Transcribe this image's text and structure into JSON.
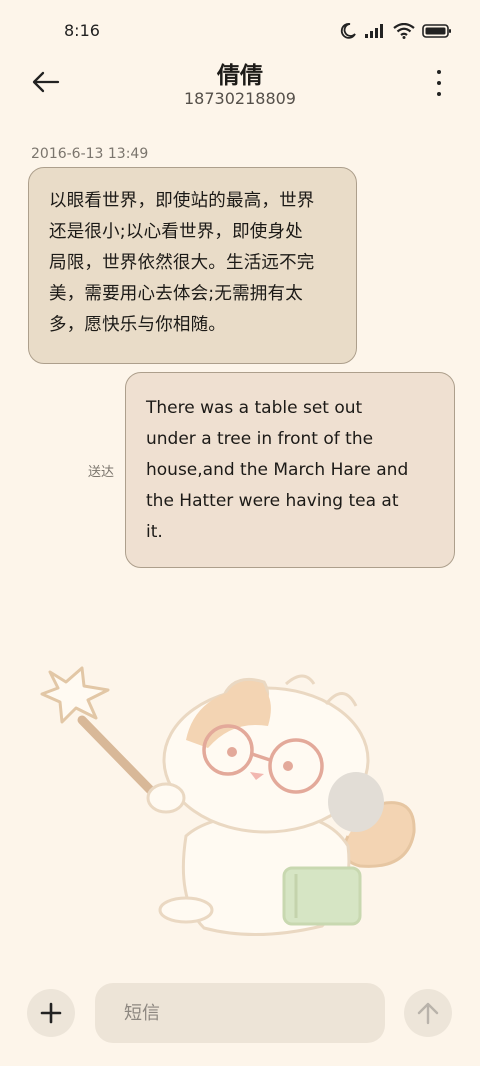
{
  "status_bar": {
    "time": "8:16",
    "icons": [
      "moon-icon",
      "signal-icon",
      "wifi-icon",
      "battery-icon"
    ]
  },
  "header": {
    "contact_name": "倩倩",
    "contact_number": "18730218809"
  },
  "conversation": {
    "timestamp": "2016-6-13 13:49",
    "messages": [
      {
        "direction": "incoming",
        "lines": [
          "以眼看世界，即使站的最高，世界",
          "还是很小;以心看世界，即使身处",
          "局限，世界依然很大。生活远不完",
          "美，需要用心去体会;无需拥有太",
          "多，愿快乐与你相随。"
        ]
      },
      {
        "direction": "outgoing",
        "status": "送达",
        "lines": [
          "There was a table set out",
          "under a tree in front of the",
          "house,and the March Hare and",
          "the Hatter were having tea at",
          "it."
        ]
      }
    ]
  },
  "composer": {
    "placeholder": "短信",
    "value": ""
  },
  "colors": {
    "background": "#fdf5ea",
    "incoming_bubble": "#e9dcc8",
    "outgoing_bubble": "#efe0d1",
    "bubble_border": "#ad9f8c"
  }
}
